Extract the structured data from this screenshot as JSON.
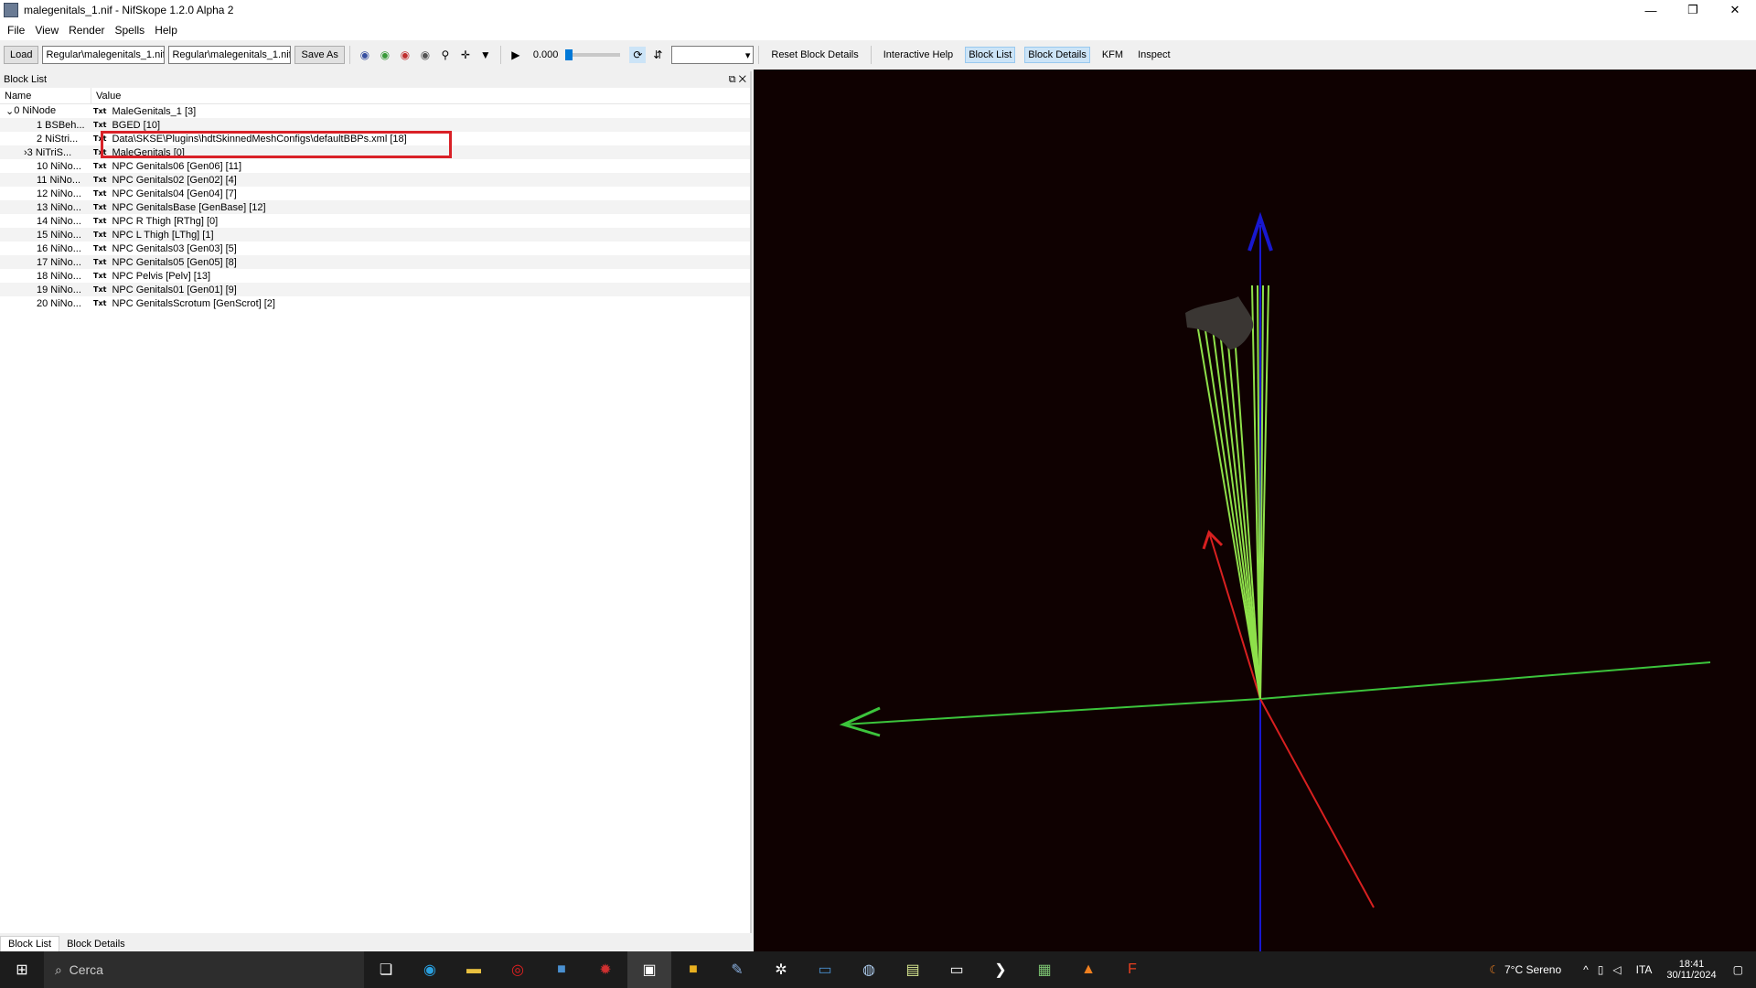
{
  "window": {
    "title": "malegenitals_1.nif - NifSkope 1.2.0 Alpha 2"
  },
  "menu": [
    "File",
    "View",
    "Render",
    "Spells",
    "Help"
  ],
  "toolbar": {
    "load": "Load",
    "path1": "Regular\\malegenitals_1.nif",
    "path2": "Regular\\malegenitals_1.nif",
    "save_as": "Save As",
    "time": "0.000",
    "reset": "Reset Block Details",
    "help": "Interactive Help",
    "block_list": "Block List",
    "block_details": "Block Details",
    "kfm": "KFM",
    "inspect": "Inspect"
  },
  "panel": {
    "title": "Block List",
    "col_name": "Name",
    "col_value": "Value"
  },
  "rows": [
    {
      "name": "0 NiNode",
      "value": "MaleGenitals_1 [3]"
    },
    {
      "name": "1 BSBeh...",
      "value": "BGED [10]"
    },
    {
      "name": "2 NiStri...",
      "value": "Data\\SKSE\\Plugins\\hdtSkinnedMeshConfigs\\defaultBBPs.xml [18]"
    },
    {
      "name": "3 NiTriS...",
      "value": "MaleGenitals [0]"
    },
    {
      "name": "10 NiNo...",
      "value": "NPC Genitals06 [Gen06] [11]"
    },
    {
      "name": "11 NiNo...",
      "value": "NPC Genitals02 [Gen02] [4]"
    },
    {
      "name": "12 NiNo...",
      "value": "NPC Genitals04 [Gen04] [7]"
    },
    {
      "name": "13 NiNo...",
      "value": "NPC GenitalsBase [GenBase] [12]"
    },
    {
      "name": "14 NiNo...",
      "value": "NPC R Thigh [RThg] [0]"
    },
    {
      "name": "15 NiNo...",
      "value": "NPC L Thigh [LThg] [1]"
    },
    {
      "name": "16 NiNo...",
      "value": "NPC Genitals03 [Gen03] [5]"
    },
    {
      "name": "17 NiNo...",
      "value": "NPC Genitals05 [Gen05] [8]"
    },
    {
      "name": "18 NiNo...",
      "value": "NPC Pelvis [Pelv] [13]"
    },
    {
      "name": "19 NiNo...",
      "value": "NPC Genitals01 [Gen01] [9]"
    },
    {
      "name": "20 NiNo...",
      "value": "NPC GenitalsScrotum [GenScrot] [2]"
    }
  ],
  "txt_label": "Txt",
  "bottom_tabs": {
    "list": "Block List",
    "details": "Block Details"
  },
  "taskbar": {
    "search": "Cerca",
    "weather": "7°C Sereno",
    "lang": "ITA",
    "time": "18:41",
    "date": "30/11/2024"
  }
}
